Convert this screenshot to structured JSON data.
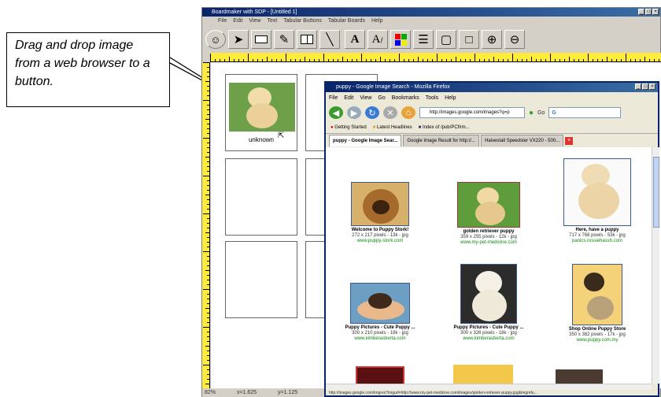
{
  "callout": {
    "text": "Drag and drop image from a web browser to a button."
  },
  "app": {
    "title": "Boardmaker with SDP - [Untitled 1]",
    "menu": [
      "File",
      "Edit",
      "View",
      "Text",
      "Tabular Buttons",
      "Tabular Boards",
      "Help"
    ],
    "toolbar": [
      "pointer-tool",
      "button-tool",
      "freeform-tool",
      "grid-tool",
      "line-tool",
      "text-tool",
      "text-style-tool",
      "color-tool",
      "line-thickness-tool",
      "corner-tool",
      "frame-tool",
      "zoom-in-tool",
      "zoom-out-tool"
    ],
    "canvas_caption": "unknown",
    "status": {
      "zoom": "82%",
      "x": "x=1.625",
      "y": "y=1.125"
    }
  },
  "browser": {
    "title": "puppy - Google Image Search - Mozilla Firefox",
    "menu": [
      "File",
      "Edit",
      "View",
      "Go",
      "Bookmarks",
      "Tools",
      "Help"
    ],
    "url": "http://images.google.com/images?q=p",
    "go_label": "Go",
    "search_value": "G",
    "bookmarks": [
      "Getting Started",
      "Latest Headlines",
      "Index of /pub/PCfirm..."
    ],
    "tabs": [
      "puppy - Google Image Sear...",
      "Google Image Result for http://...",
      "Haivestall Speedster VX220 - 500..."
    ],
    "status": "http://images.google.com/imgres?imgurl=http://www.my-pet-medicine.com/images/golden-retriever-puppy.jpg&imgrefu...",
    "results": [
      {
        "title": "Welcome to Puppy Stork!",
        "size": "272 x 217 pixels - 13k - jpg",
        "url": "www.puppy-stork.com"
      },
      {
        "title": "golden retriever puppy",
        "size": "359 x 255 pixels - 12k - jpg",
        "url": "www.my-pet-medicine.com"
      },
      {
        "title": "Here, have a puppy",
        "size": "717 x 768 pixels - 53k - jpg",
        "url": "panics.rossiehassh.com"
      },
      {
        "title": "Puppy Pictures - Cute Puppy ...",
        "size": "300 x 210 pixels - 18k - jpg",
        "url": "www.kimberasberta.com"
      },
      {
        "title": "Puppy Pictures - Cute Puppy ...",
        "size": "300 x 326 pixels - 18k - jpg",
        "url": "www.kimberasberta.com"
      },
      {
        "title": "Shop Online Puppy Store",
        "size": "350 x 382 pixels - 17k - jpg",
        "url": "www.puppy.com.my"
      }
    ]
  },
  "colors": {
    "ruler": "#ffeb3b",
    "titlebar": "#0a246a",
    "link_green": "#0a8a0a"
  }
}
